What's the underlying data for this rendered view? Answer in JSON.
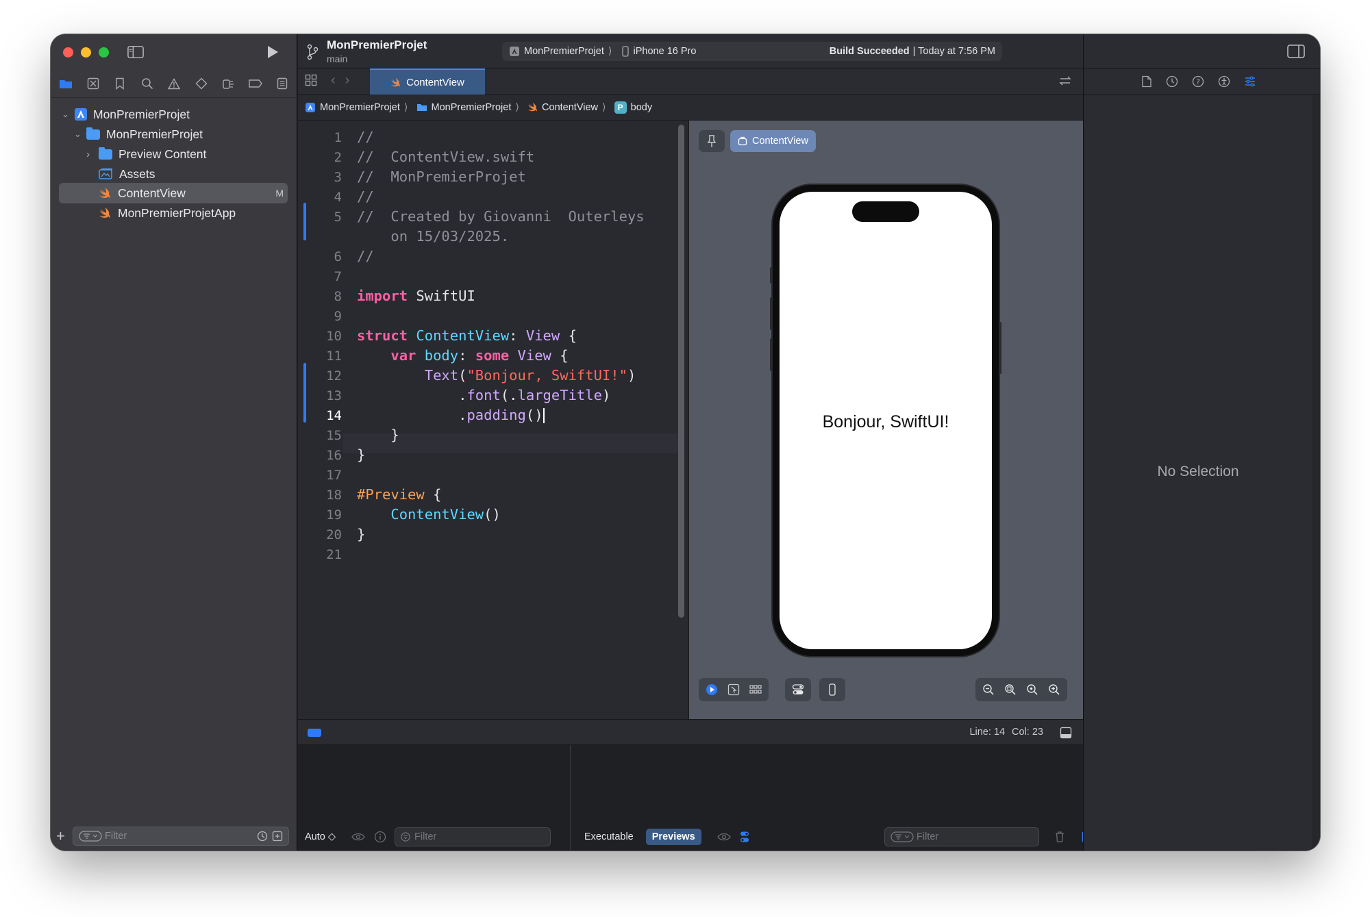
{
  "project": {
    "name": "MonPremierProjet",
    "branch": "main",
    "scheme": "MonPremierProjet",
    "device": "iPhone 16 Pro",
    "build_status_bold": "Build Succeeded",
    "build_status_time": "| Today at 7:56 PM"
  },
  "navigator": {
    "tree": [
      {
        "label": "MonPremierProjet",
        "kind": "project"
      },
      {
        "label": "MonPremierProjet",
        "kind": "folder"
      },
      {
        "label": "Preview Content",
        "kind": "folder"
      },
      {
        "label": "Assets",
        "kind": "assets"
      },
      {
        "label": "ContentView",
        "kind": "swift",
        "badge": "M"
      },
      {
        "label": "MonPremierProjetApp",
        "kind": "swift"
      }
    ],
    "filter_placeholder": "Filter"
  },
  "tab": {
    "label": "ContentView"
  },
  "jumpbar": {
    "items": [
      "MonPremierProjet",
      "MonPremierProjet",
      "ContentView",
      "body"
    ],
    "body_badge": "P"
  },
  "code": {
    "line_numbers": [
      "1",
      "2",
      "3",
      "4",
      "5",
      "",
      "6",
      "7",
      "8",
      "9",
      "10",
      "11",
      "12",
      "13",
      "14",
      "15",
      "16",
      "17",
      "18",
      "19",
      "20",
      "21"
    ],
    "l1": "//",
    "l2": "//  ContentView.swift",
    "l3": "//  MonPremierProjet",
    "l4": "//",
    "l5a": "//  Created by Giovanni  Outerleys",
    "l5b": "    on 15/03/2025.",
    "l6": "//",
    "l8_kw": "import",
    "l8_mod": " SwiftUI",
    "l10_kw": "struct",
    "l10_name": " ContentView",
    "l10_colon": ": ",
    "l10_type": "View",
    "l10_brace": " {",
    "l11_indent": "    ",
    "l11_kw": "var",
    "l11_name": " body",
    "l11_colon": ": ",
    "l11_kw2": "some",
    "l11_type": " View",
    "l11_brace": " {",
    "l12_indent": "        ",
    "l12_fn": "Text",
    "l12_open": "(",
    "l12_str": "\"Bonjour, SwiftUI!\"",
    "l12_close": ")",
    "l13_indent": "            .",
    "l13_fn": "font",
    "l13_mid": "(.",
    "l13_arg": "largeTitle",
    "l13_close": ")",
    "l14_indent": "            .",
    "l14_fn": "padding",
    "l14_close": "()",
    "l15": "    }",
    "l16": "}",
    "l18_macro": "#Preview",
    "l18_brace": " {",
    "l19_indent": "    ",
    "l19_fn": "ContentView",
    "l19_close": "()",
    "l20": "}"
  },
  "preview": {
    "tab_label": "ContentView",
    "phone_text": "Bonjour, SwiftUI!"
  },
  "status": {
    "line": "Line: 14",
    "col": "Col: 23"
  },
  "debug": {
    "auto_label": "Auto ◇",
    "filter_placeholder": "Filter",
    "tab_executable": "Executable",
    "tab_previews": "Previews"
  },
  "inspector": {
    "empty_label": "No Selection"
  },
  "colors": {
    "accent": "#2f7bf5",
    "sidebar_bg": "#3a3a3e",
    "editor_bg": "#292a30",
    "canvas_bg": "#545963"
  }
}
